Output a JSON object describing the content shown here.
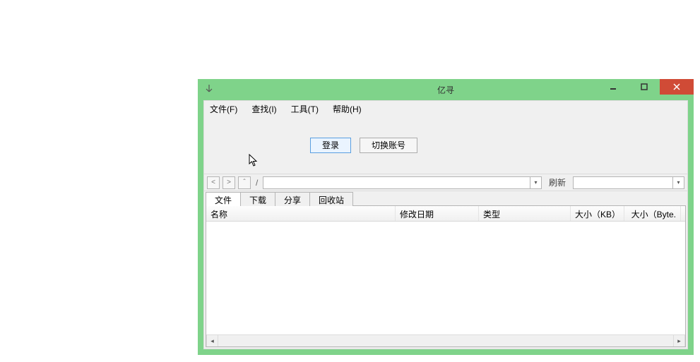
{
  "titlebar": {
    "title": "亿寻",
    "icon_name": "app-icon"
  },
  "menubar": {
    "items": [
      "文件(F)",
      "查找(I)",
      "工具(T)",
      "帮助(H)"
    ]
  },
  "toolbar": {
    "login_label": "登录",
    "switch_account_label": "切换账号"
  },
  "pathbar": {
    "back": "<",
    "forward": ">",
    "up": "ˆ",
    "path_label": "/",
    "refresh_label": "刷新"
  },
  "tabs": {
    "items": [
      "文件",
      "下载",
      "分享",
      "回收站"
    ],
    "active_index": 0
  },
  "table": {
    "columns": [
      "名称",
      "修改日期",
      "类型",
      "大小（KB）",
      "大小（Byte."
    ]
  }
}
